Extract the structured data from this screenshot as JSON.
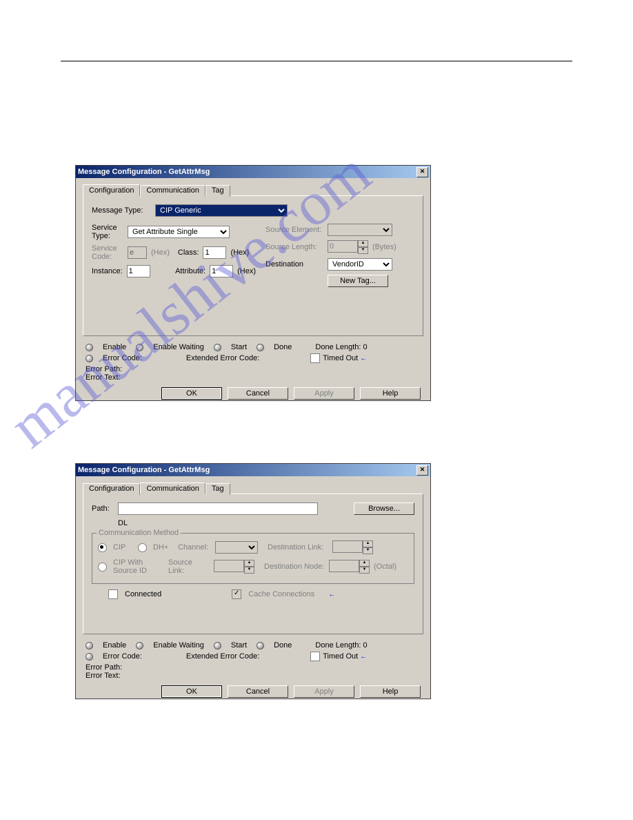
{
  "window_title": "Message Configuration - GetAttrMsg",
  "tabs": {
    "config": "Configuration",
    "comm": "Communication",
    "tag": "Tag"
  },
  "cfg": {
    "msg_type_lbl": "Message Type:",
    "msg_type_val": "CIP Generic",
    "svc_type_lbl": "Service\nType:",
    "svc_type_val": "Get Attribute Single",
    "svc_code_lbl": "Service\nCode:",
    "svc_code_val": "e",
    "hex": "(Hex)",
    "class_lbl": "Class:",
    "class_val": "1",
    "instance_lbl": "Instance:",
    "instance_val": "1",
    "attr_lbl": "Attribute:",
    "attr_val": "1",
    "src_elem_lbl": "Source Element:",
    "src_len_lbl": "Source Length:",
    "src_len_val": "0",
    "bytes": "(Bytes)",
    "dest_lbl": "Destination",
    "dest_val": "VendorID",
    "new_tag_btn": "New Tag..."
  },
  "comm": {
    "path_lbl": "Path:",
    "path_val": "DL",
    "path_echo": "DL",
    "browse_btn": "Browse...",
    "grp_title": "Communication Method",
    "cip": "CIP",
    "dhp": "DH+",
    "channel_lbl": "Channel:",
    "dest_link_lbl": "Destination Link:",
    "cip_src": "CIP With\nSource ID",
    "src_link_lbl": "Source Link:",
    "dest_node_lbl": "Destination Node:",
    "octal": "(Octal)",
    "connected_lbl": "Connected",
    "cache_lbl": "Cache Connections"
  },
  "status": {
    "enable": "Enable",
    "enable_wait": "Enable Waiting",
    "start": "Start",
    "done": "Done",
    "done_len": "Done Length:  0",
    "err_code": "Error Code:",
    "ext_err": "Extended Error Code:",
    "timed_out": "Timed Out",
    "err_path": "Error Path:",
    "err_text": "Error Text:"
  },
  "buttons": {
    "ok": "OK",
    "cancel": "Cancel",
    "apply": "Apply",
    "help": "Help"
  }
}
